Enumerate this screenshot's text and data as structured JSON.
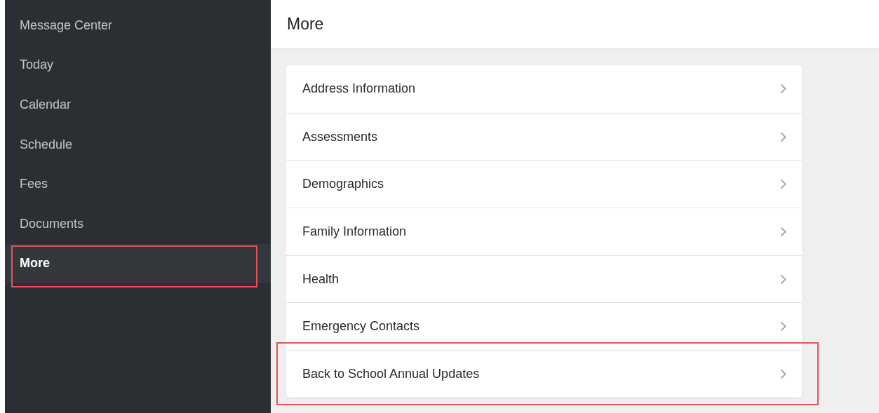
{
  "sidebar": {
    "items": [
      {
        "label": "Message Center",
        "selected": false,
        "highlighted": false
      },
      {
        "label": "Today",
        "selected": false,
        "highlighted": false
      },
      {
        "label": "Calendar",
        "selected": false,
        "highlighted": false
      },
      {
        "label": "Schedule",
        "selected": false,
        "highlighted": false
      },
      {
        "label": "Fees",
        "selected": false,
        "highlighted": false
      },
      {
        "label": "Documents",
        "selected": false,
        "highlighted": false
      },
      {
        "label": "More",
        "selected": true,
        "highlighted": true
      }
    ]
  },
  "page": {
    "title": "More",
    "items": [
      {
        "label": "Address Information",
        "highlighted": false
      },
      {
        "label": "Assessments",
        "highlighted": false
      },
      {
        "label": "Demographics",
        "highlighted": false
      },
      {
        "label": "Family Information",
        "highlighted": false
      },
      {
        "label": "Health",
        "highlighted": false
      },
      {
        "label": "Emergency Contacts",
        "highlighted": false
      },
      {
        "label": "Back to School Annual Updates",
        "highlighted": true
      }
    ]
  }
}
